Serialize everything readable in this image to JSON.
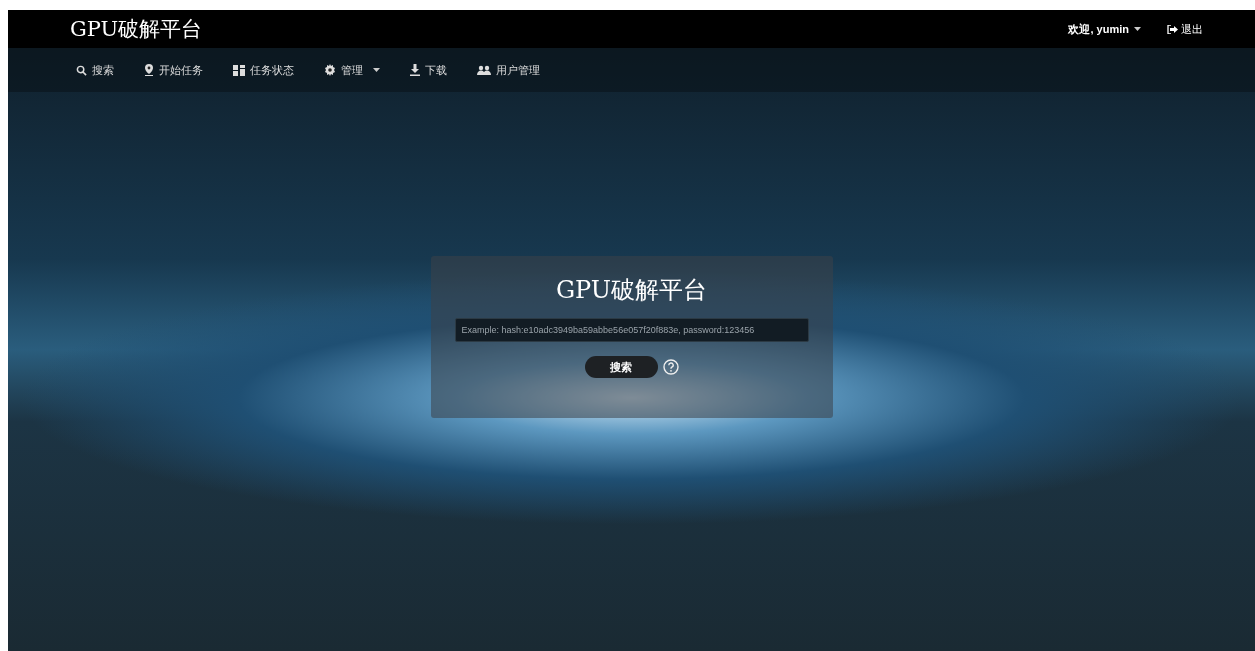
{
  "brand": "GPU破解平台",
  "user_menu": {
    "label": "欢迎, yumin",
    "dropdown": true
  },
  "logout": {
    "label": "退出"
  },
  "nav": [
    {
      "kind": "search",
      "label": "搜索",
      "dropdown": false
    },
    {
      "kind": "pin",
      "label": "开始任务",
      "dropdown": false
    },
    {
      "kind": "grid",
      "label": "任务状态",
      "dropdown": false
    },
    {
      "kind": "gear",
      "label": "管理",
      "dropdown": true
    },
    {
      "kind": "download",
      "label": "下载",
      "dropdown": false
    },
    {
      "kind": "users",
      "label": "用户管理",
      "dropdown": false
    }
  ],
  "search_card": {
    "title": "GPU破解平台",
    "placeholder": "Example: hash:e10adc3949ba59abbe56e057f20f883e, password:123456",
    "button": "搜索"
  }
}
